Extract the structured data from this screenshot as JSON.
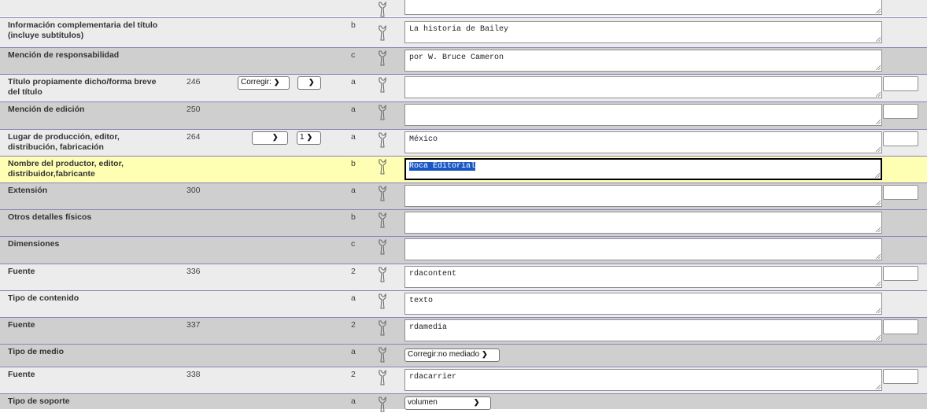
{
  "rows": [
    {
      "label": "",
      "tag": "",
      "sub": "",
      "value": ""
    },
    {
      "label": "Información complementaria del título (incluye subtítulos)",
      "tag": "",
      "sub": "b",
      "value": "La historia de Bailey"
    },
    {
      "label": "Mención de responsabilidad",
      "tag": "",
      "sub": "c",
      "value": "por W. Bruce Cameron"
    },
    {
      "label": "Título propiamente dicho/forma breve del título",
      "tag": "246",
      "sub": "a",
      "value": "",
      "select1": "Corregir:",
      "select2": ""
    },
    {
      "label": "Mención de edición",
      "tag": "250",
      "sub": "a",
      "value": ""
    },
    {
      "label": "Lugar de producción, editor, distribución, fabricación",
      "tag": "264",
      "sub": "a",
      "value": "México",
      "select1": "",
      "select2": "1"
    },
    {
      "label": "Nombre del productor, editor, distribuidor,fabricante",
      "tag": "",
      "sub": "b",
      "value": "Roca Editorial"
    },
    {
      "label": "Extensión",
      "tag": "300",
      "sub": "a",
      "value": ""
    },
    {
      "label": "Otros detalles físicos",
      "tag": "",
      "sub": "b",
      "value": ""
    },
    {
      "label": "Dimensiones",
      "tag": "",
      "sub": "c",
      "value": ""
    },
    {
      "label": "Fuente",
      "tag": "336",
      "sub": "2",
      "value": "rdacontent"
    },
    {
      "label": "Tipo de contenido",
      "tag": "",
      "sub": "a",
      "value": "texto"
    },
    {
      "label": "Fuente",
      "tag": "337",
      "sub": "2",
      "value": "rdamedia"
    },
    {
      "label": "Tipo de medio",
      "tag": "",
      "sub": "a",
      "select_value": "Corregir:no mediado"
    },
    {
      "label": "Fuente",
      "tag": "338",
      "sub": "2",
      "value": "rdacarrier"
    },
    {
      "label": "Tipo de soporte",
      "tag": "",
      "sub": "a",
      "select_value": "volumen"
    }
  ],
  "icons": {
    "edit": "wrench-icon",
    "resize": "resize-grip-icon",
    "dropdown": "chevron-down-icon"
  },
  "colors": {
    "row_dark": "#cfcfcf",
    "row_light": "#ececec",
    "row_highlight": "#ffffb3",
    "separator": "#8a83b8",
    "selection": "#1a57c4"
  }
}
